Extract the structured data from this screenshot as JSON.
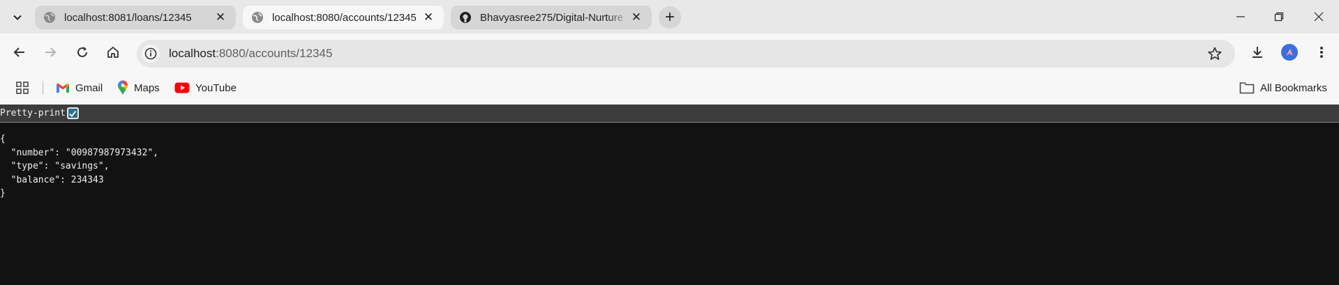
{
  "tabs": [
    {
      "title": "localhost:8081/loans/12345",
      "active": false,
      "icon": "globe-icon"
    },
    {
      "title": "localhost:8080/accounts/12345",
      "active": true,
      "icon": "globe-icon"
    },
    {
      "title": "Bhavyasree275/Digital-Nurture",
      "active": false,
      "icon": "github-icon"
    }
  ],
  "omnibox": {
    "host": "localhost",
    "rest": ":8080/accounts/12345"
  },
  "bookmarks": [
    {
      "label": "Gmail",
      "icon": "gmail-icon"
    },
    {
      "label": "Maps",
      "icon": "maps-icon"
    },
    {
      "label": "YouTube",
      "icon": "youtube-icon"
    }
  ],
  "all_bookmarks_label": "All Bookmarks",
  "page": {
    "pretty_print_label": "Pretty-print",
    "pretty_print_checked": true,
    "json": {
      "open": "{",
      "number_line": "  \"number\": \"00987987973432\",",
      "type_line": "  \"type\": \"savings\",",
      "balance_line": "  \"balance\": 234343",
      "close": "}"
    }
  },
  "colors": {
    "page_bg": "#121212",
    "tabstrip_bg": "#e8e8e8",
    "toolbar_bg": "#f7f7f7",
    "avatar": "#3b6fe0"
  }
}
